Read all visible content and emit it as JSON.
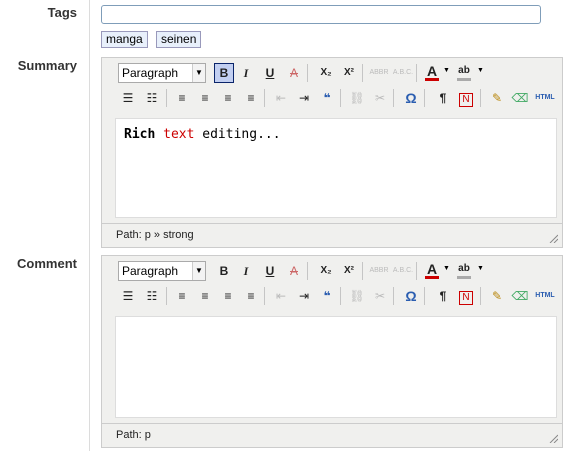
{
  "tags": {
    "label": "Tags",
    "input_value": "",
    "chips": [
      "manga",
      "seinen"
    ]
  },
  "summary": {
    "label": "Summary",
    "format_select": "Paragraph",
    "content": {
      "part1_strong": "Rich",
      "part2_red": "text",
      "part3": "editing..."
    },
    "path": "Path: p » strong"
  },
  "comment": {
    "label": "Comment",
    "format_select": "Paragraph",
    "path": "Path: p"
  },
  "toolbar": {
    "bold": "B",
    "italic": "I",
    "underline": "U",
    "strike": "A",
    "subscript": "X₂",
    "superscript": "X²",
    "abbr": "ABBR",
    "acronym": "A.B.C.",
    "forecolor": "A",
    "backcolor": "ab",
    "charmap": "Ω",
    "visualchars": "¶",
    "html": "HTML",
    "quote": "❝"
  },
  "colors": {
    "accent_active_bg": "#c2cff1",
    "forecolor_bar": "#cc0000",
    "backcolor_bar": "#aaaaaa",
    "red_text": "#cc0000"
  }
}
